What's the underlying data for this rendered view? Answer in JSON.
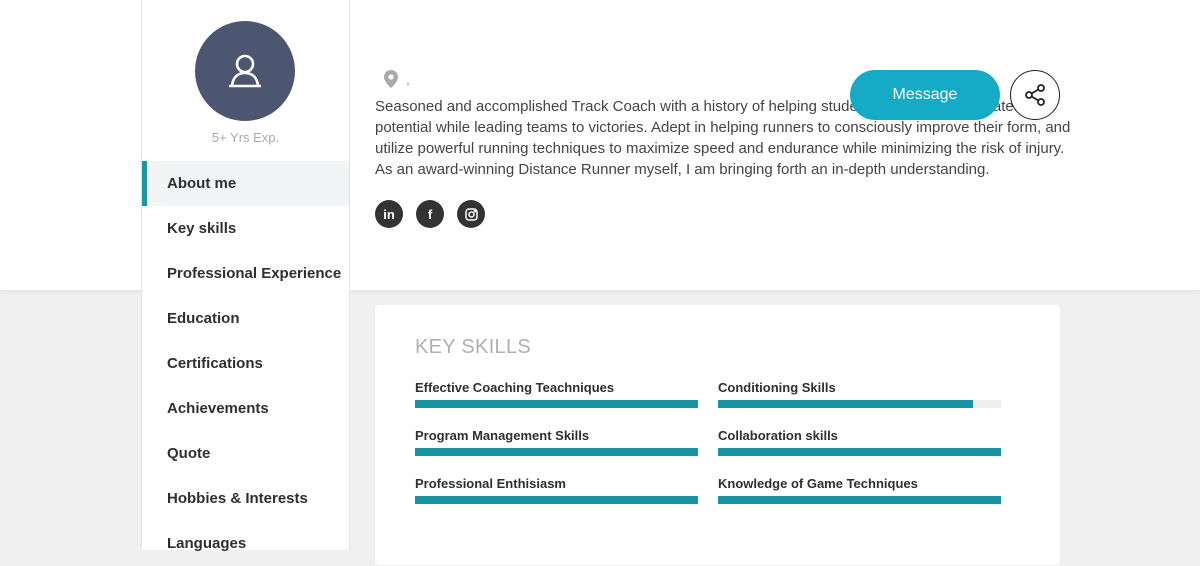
{
  "profile": {
    "experience": "5+ Yrs Exp.",
    "location_text": ",",
    "bio": "Seasoned and accomplished Track Coach with a history of helping students achieve their greatest potential while leading teams to victories. Adept in helping runners to consciously improve their form, and utilize powerful running techniques to maximize speed and endurance while minimizing the risk of injury. As an award-winning Distance Runner myself, I am bringing forth an in-depth understanding.",
    "message_label": "Message",
    "socials": [
      {
        "icon": "linkedin-icon",
        "glyph": "in"
      },
      {
        "icon": "facebook-icon",
        "glyph": "f"
      },
      {
        "icon": "instagram-icon",
        "glyph": "◻"
      }
    ]
  },
  "sidebar": {
    "items": [
      {
        "label": "About me",
        "active": true
      },
      {
        "label": "Key skills"
      },
      {
        "label": "Professional Experience"
      },
      {
        "label": "Education"
      },
      {
        "label": "Certifications"
      },
      {
        "label": "Achievements"
      },
      {
        "label": "Quote"
      },
      {
        "label": "Hobbies & Interests"
      },
      {
        "label": "Languages"
      }
    ]
  },
  "key_skills": {
    "title": "KEY SKILLS",
    "skills": [
      {
        "name": "Effective Coaching Teachniques",
        "level": 1.0
      },
      {
        "name": "Conditioning Skills",
        "level": 0.9
      },
      {
        "name": "Program Management Skills",
        "level": 1.0
      },
      {
        "name": "Collaboration skills",
        "level": 1.0
      },
      {
        "name": "Professional Enthisiasm",
        "level": 1.0
      },
      {
        "name": "Knowledge of Game Techniques",
        "level": 1.0
      }
    ]
  },
  "colors": {
    "accent": "#15abc6",
    "skill_bar": "#1893a4",
    "avatar_bg": "#4d5670"
  }
}
